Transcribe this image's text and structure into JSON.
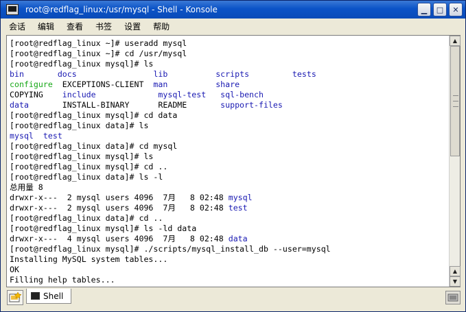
{
  "window": {
    "title": "root@redflag_linux:/usr/mysql - Shell - Konsole",
    "controls": {
      "minimize_glyph": "▁",
      "maximize_glyph": "□",
      "close_glyph": "✕"
    }
  },
  "menubar": {
    "items": [
      "会话",
      "编辑",
      "查看",
      "书签",
      "设置",
      "帮助"
    ]
  },
  "terminal": {
    "lines": [
      [
        {
          "t": "[root@redflag_linux ~]# useradd mysql"
        }
      ],
      [
        {
          "t": "[root@redflag_linux ~]# cd /usr/mysql"
        }
      ],
      [
        {
          "t": "[root@redflag_linux mysql]# ls"
        }
      ],
      [
        {
          "t": "bin",
          "c": "blue"
        },
        {
          "t": "       "
        },
        {
          "t": "docs",
          "c": "blue"
        },
        {
          "t": "                "
        },
        {
          "t": "lib",
          "c": "blue"
        },
        {
          "t": "          "
        },
        {
          "t": "scripts",
          "c": "blue"
        },
        {
          "t": "         "
        },
        {
          "t": "tests",
          "c": "blue"
        }
      ],
      [
        {
          "t": "configure",
          "c": "green"
        },
        {
          "t": "  EXCEPTIONS-CLIENT  "
        },
        {
          "t": "man",
          "c": "blue"
        },
        {
          "t": "          "
        },
        {
          "t": "share",
          "c": "blue"
        }
      ],
      [
        {
          "t": "COPYING    "
        },
        {
          "t": "include",
          "c": "blue"
        },
        {
          "t": "             "
        },
        {
          "t": "mysql-test",
          "c": "blue"
        },
        {
          "t": "   "
        },
        {
          "t": "sql-bench",
          "c": "blue"
        }
      ],
      [
        {
          "t": "data",
          "c": "blue"
        },
        {
          "t": "       INSTALL-BINARY      README       "
        },
        {
          "t": "support-files",
          "c": "blue"
        }
      ],
      [
        {
          "t": "[root@redflag_linux mysql]# cd data"
        }
      ],
      [
        {
          "t": "[root@redflag_linux data]# ls"
        }
      ],
      [
        {
          "t": "mysql",
          "c": "blue"
        },
        {
          "t": "  "
        },
        {
          "t": "test",
          "c": "blue"
        }
      ],
      [
        {
          "t": "[root@redflag_linux data]# cd mysql"
        }
      ],
      [
        {
          "t": "[root@redflag_linux mysql]# ls"
        }
      ],
      [
        {
          "t": "[root@redflag_linux mysql]# cd .."
        }
      ],
      [
        {
          "t": "[root@redflag_linux data]# ls -l"
        }
      ],
      [
        {
          "t": "总用量 8"
        }
      ],
      [
        {
          "t": "drwxr-x---  2 mysql users 4096  7月   8 02:48 "
        },
        {
          "t": "mysql",
          "c": "blue"
        }
      ],
      [
        {
          "t": "drwxr-x---  2 mysql users 4096  7月   8 02:48 "
        },
        {
          "t": "test",
          "c": "blue"
        }
      ],
      [
        {
          "t": "[root@redflag_linux data]# cd .."
        }
      ],
      [
        {
          "t": "[root@redflag_linux mysql]# ls -ld data"
        }
      ],
      [
        {
          "t": "drwxr-x---  4 mysql users 4096  7月   8 02:48 "
        },
        {
          "t": "data",
          "c": "blue"
        }
      ],
      [
        {
          "t": "[root@redflag_linux mysql]# ./scripts/mysql_install_db --user=mysql"
        }
      ],
      [
        {
          "t": "Installing MySQL system tables..."
        }
      ],
      [
        {
          "t": "OK"
        }
      ],
      [
        {
          "t": "Filling help tables..."
        }
      ]
    ]
  },
  "scrollbar": {
    "up_glyph": "▲",
    "down_glyph": "▼",
    "thumb_start": 0.0,
    "thumb_size": 0.5
  },
  "tabbar": {
    "tabs": [
      {
        "label": "Shell",
        "active": true
      }
    ]
  },
  "colors": {
    "blue": "#1818b2",
    "green": "#18a818",
    "title_bar": "#0b53c7"
  }
}
